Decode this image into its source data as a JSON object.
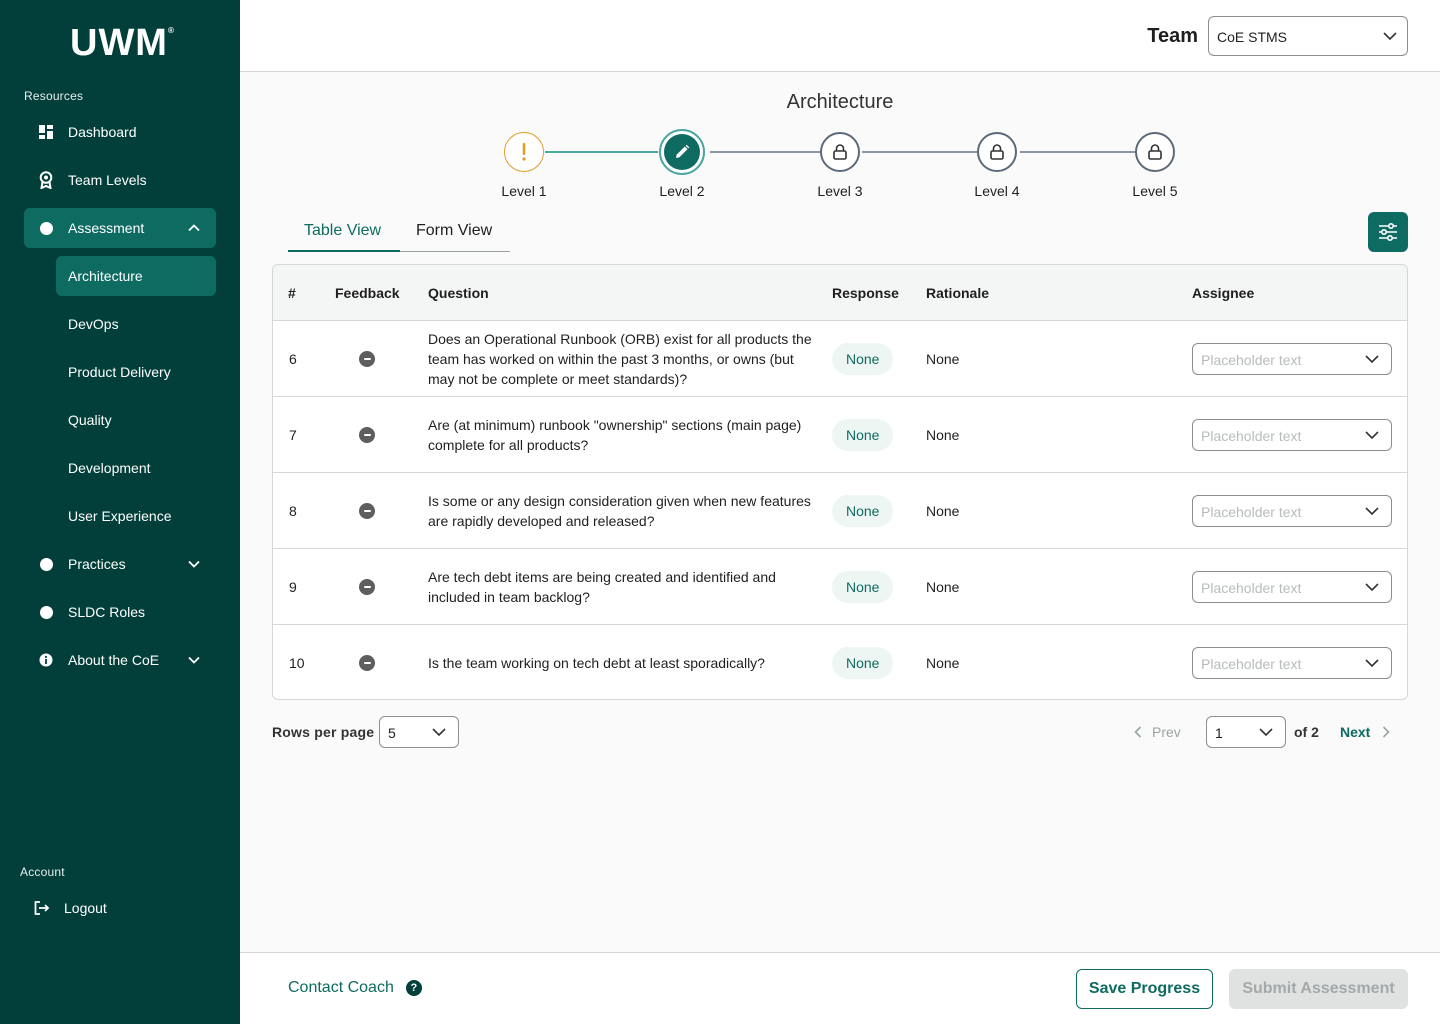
{
  "brand": {
    "logo": "UWM",
    "trademark": "®"
  },
  "sidebar": {
    "resources_label": "Resources",
    "items": [
      {
        "label": "Dashboard",
        "icon": "dashboard-icon"
      },
      {
        "label": "Team Levels",
        "icon": "award-icon"
      },
      {
        "label": "Assessment",
        "icon": "dot-icon",
        "expanded": true
      },
      {
        "label": "Practices",
        "icon": "dot-icon"
      },
      {
        "label": "SLDC Roles",
        "icon": "dot-icon"
      },
      {
        "label": "About the CoE",
        "icon": "info-icon"
      }
    ],
    "assessment_subitems": [
      {
        "label": "Architecture",
        "active": true
      },
      {
        "label": "DevOps"
      },
      {
        "label": "Product Delivery"
      },
      {
        "label": "Quality"
      },
      {
        "label": "Development"
      },
      {
        "label": "User Experience"
      }
    ],
    "account_label": "Account",
    "logout_label": "Logout"
  },
  "header": {
    "team_label": "Team",
    "team_value": "CoE STMS"
  },
  "main": {
    "title": "Architecture",
    "levels": [
      {
        "label": "Level 1",
        "state": "warning"
      },
      {
        "label": "Level 2",
        "state": "current"
      },
      {
        "label": "Level 3",
        "state": "locked"
      },
      {
        "label": "Level 4",
        "state": "locked"
      },
      {
        "label": "Level 5",
        "state": "locked"
      }
    ],
    "tabs": [
      {
        "label": "Table View",
        "active": true
      },
      {
        "label": "Form View"
      }
    ]
  },
  "table": {
    "headers": {
      "num": "#",
      "feedback": "Feedback",
      "question": "Question",
      "response": "Response",
      "rationale": "Rationale",
      "assignee": "Assignee"
    },
    "rows": [
      {
        "num": "6",
        "question": "Does an Operational Runbook (ORB) exist for all products the team has worked on within the past 3 months, or owns (but may not be complete or meet standards)?",
        "response": "None",
        "rationale": "None",
        "assignee_placeholder": "Placeholder text"
      },
      {
        "num": "7",
        "question": "Are (at minimum) runbook \"ownership\" sections (main page) complete for all products?",
        "response": "None",
        "rationale": "None",
        "assignee_placeholder": "Placeholder text"
      },
      {
        "num": "8",
        "question": "Is some or any design consideration given when new features are rapidly developed and released?",
        "response": "None",
        "rationale": "None",
        "assignee_placeholder": "Placeholder text"
      },
      {
        "num": "9",
        "question": "Are tech debt items are being created and identified and included in team backlog?",
        "response": "None",
        "rationale": "None",
        "assignee_placeholder": "Placeholder text"
      },
      {
        "num": "10",
        "question": "Is the team working on tech debt at least sporadically?",
        "response": "None",
        "rationale": "None",
        "assignee_placeholder": "Placeholder text"
      }
    ]
  },
  "pagination": {
    "rows_label": "Rows per page",
    "rows_value": "5",
    "prev": "Prev",
    "page_value": "1",
    "of_label": "of 2",
    "next": "Next"
  },
  "footer": {
    "contact": "Contact Coach",
    "help_glyph": "?",
    "save": "Save Progress",
    "submit": "Submit Assessment"
  },
  "colors": {
    "sidebar": "#023f3a",
    "accent": "#0e6b61",
    "warning": "#e39b2a"
  }
}
